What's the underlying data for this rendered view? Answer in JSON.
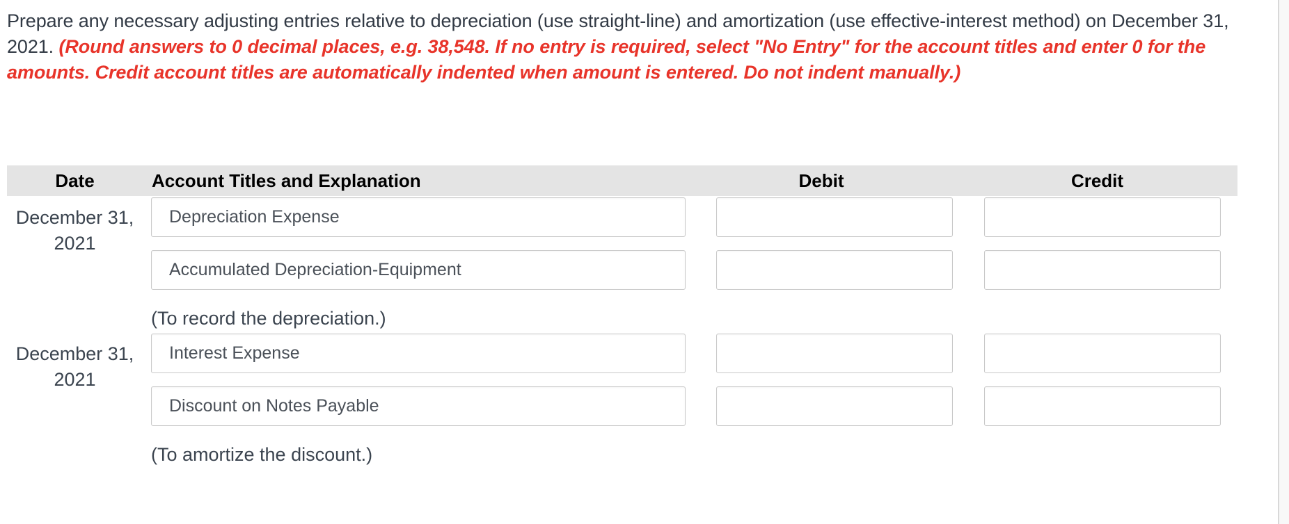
{
  "instructions": {
    "part1": "Prepare any necessary adjusting entries relative to depreciation (use straight-line) and amortization (use effective-interest method) on December 31, 2021. ",
    "part2": "(Round answers to 0 decimal places, e.g. 38,548. If no entry is required, select \"No Entry\" for the account titles and enter 0 for the amounts. Credit account titles are automatically indented when amount is entered. Do not indent manually.)"
  },
  "colors": {
    "emphasis_red": "#e8342a",
    "body_text": "#323a45",
    "header_bar": "#e4e4e4",
    "field_border": "#c9c9c9"
  },
  "table": {
    "headers": {
      "date": "Date",
      "account": "Account Titles and Explanation",
      "debit": "Debit",
      "credit": "Credit"
    },
    "entries": [
      {
        "date": "December 31, 2021",
        "lines": [
          {
            "account": "Depreciation Expense",
            "debit": "",
            "credit": ""
          },
          {
            "account": "Accumulated Depreciation-Equipment",
            "debit": "",
            "credit": ""
          }
        ],
        "memo": "(To record the depreciation.)"
      },
      {
        "date": "December 31, 2021",
        "lines": [
          {
            "account": "Interest Expense",
            "debit": "",
            "credit": ""
          },
          {
            "account": "Discount on Notes Payable",
            "debit": "",
            "credit": ""
          }
        ],
        "memo": "(To amortize the discount.)"
      }
    ]
  }
}
